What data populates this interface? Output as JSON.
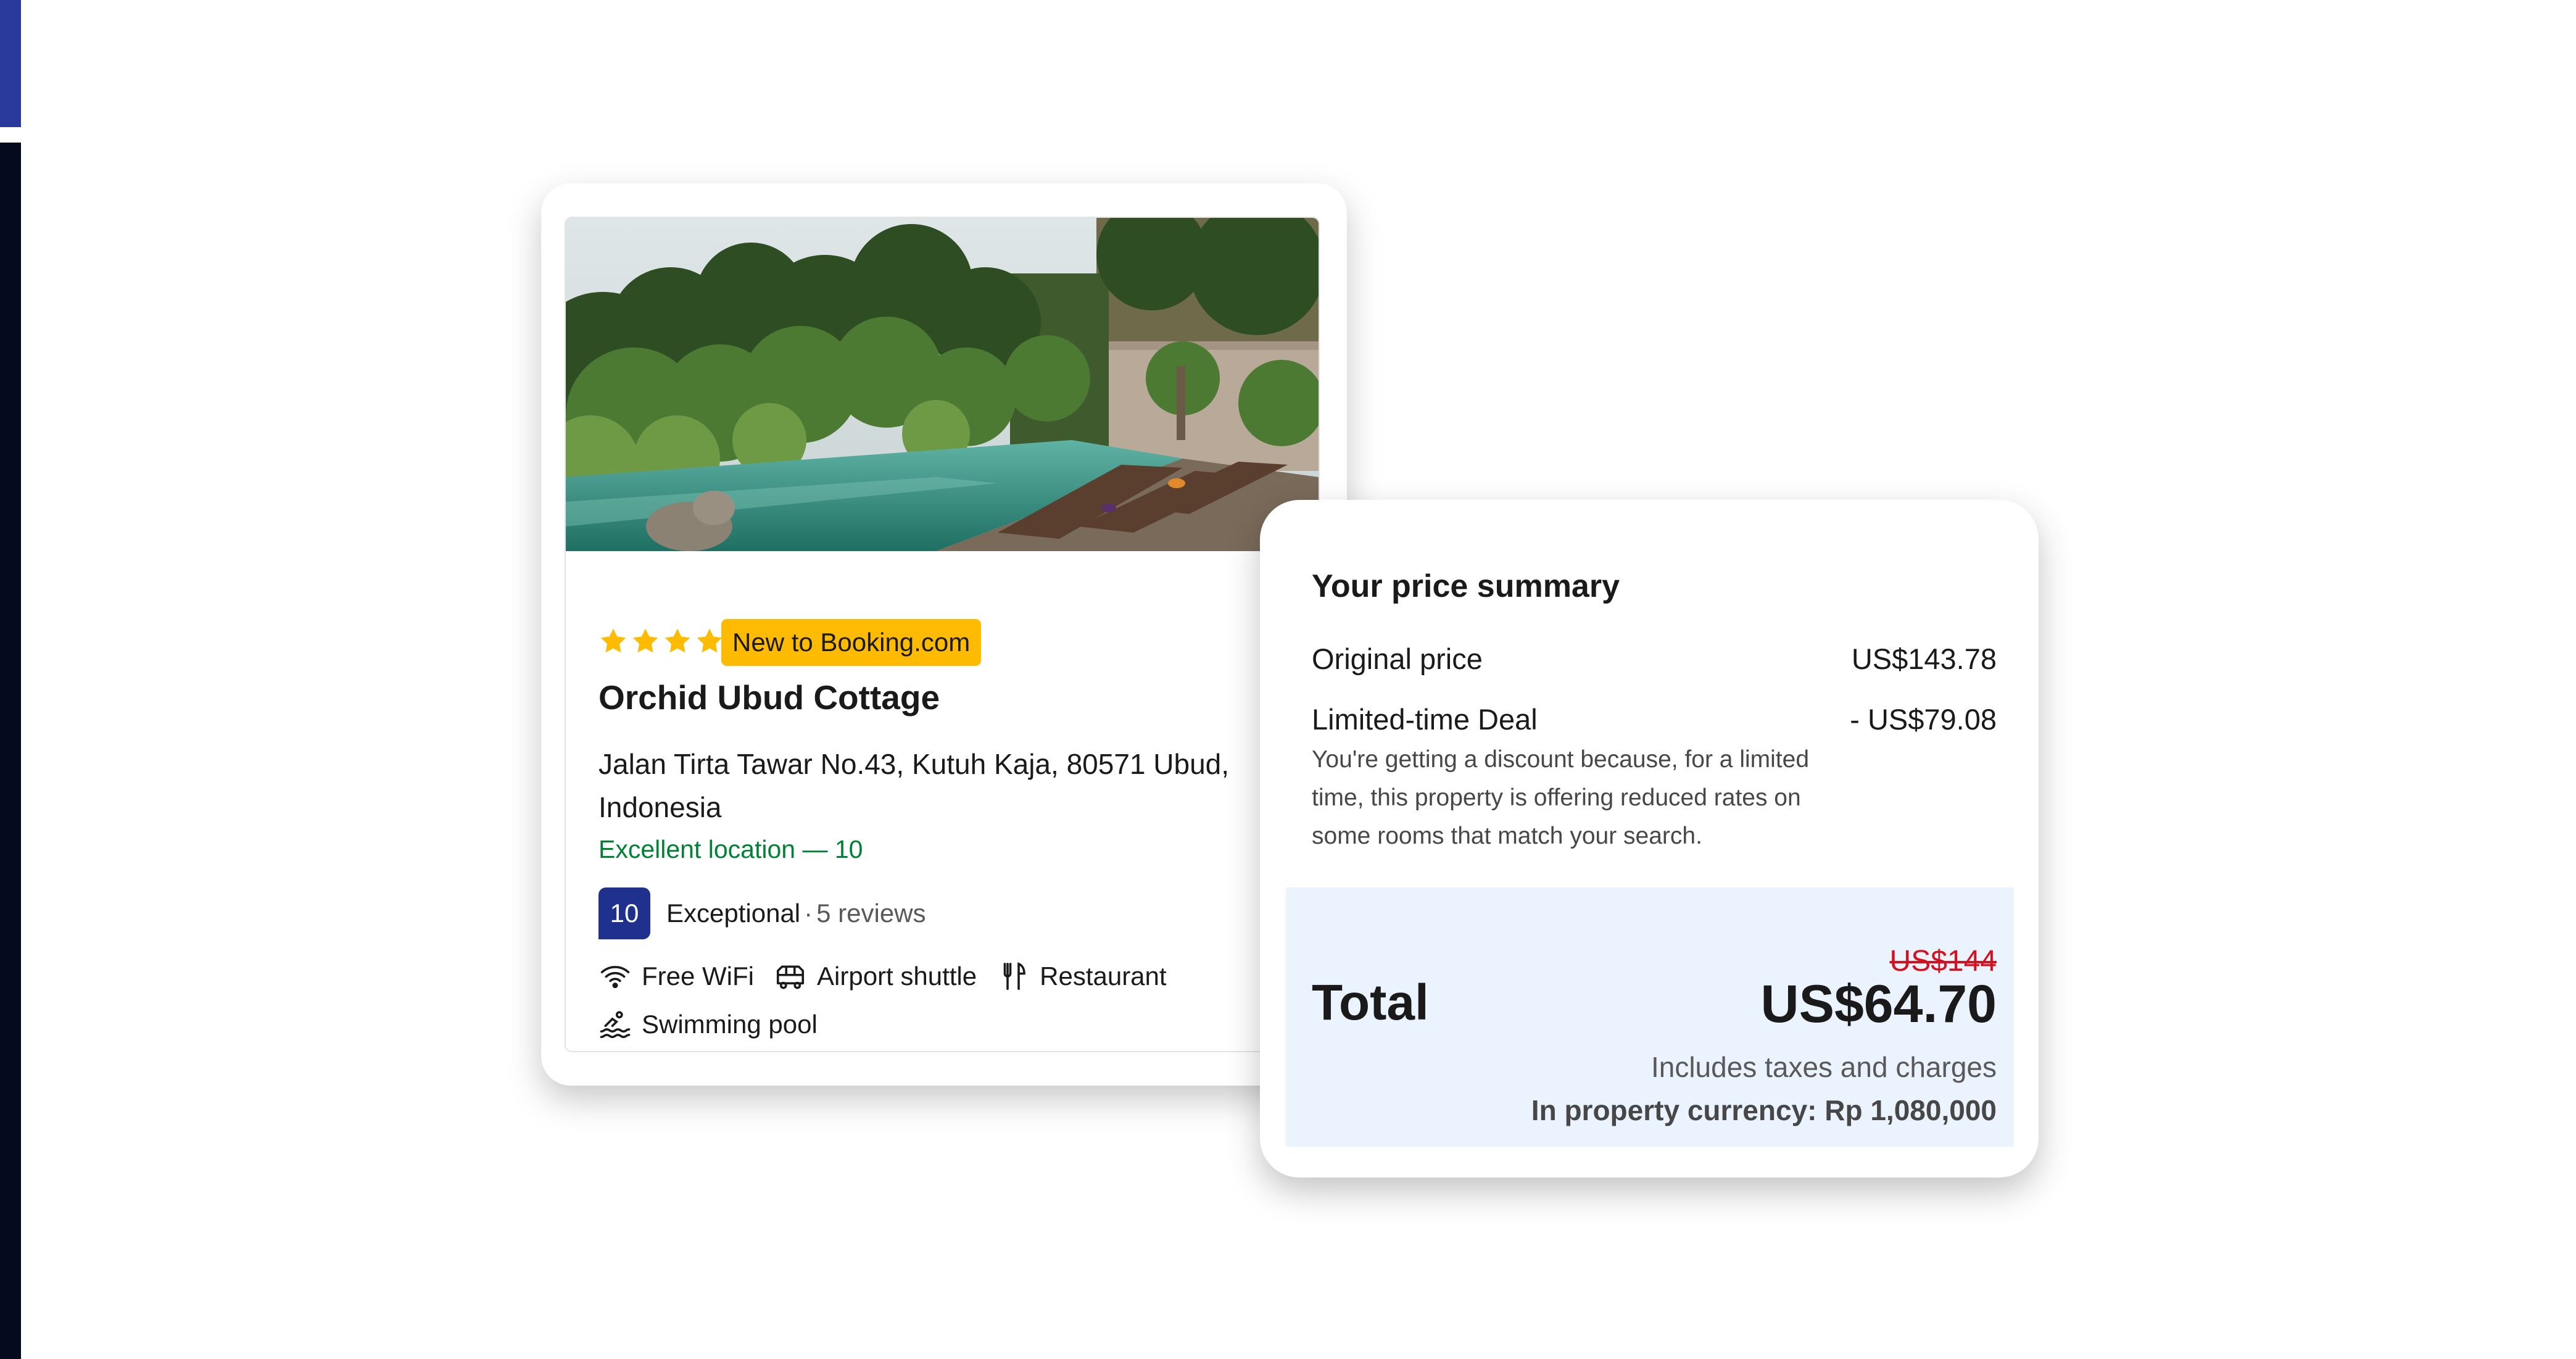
{
  "listing": {
    "star_rating": 4,
    "badge": "New to Booking.com",
    "name": "Orchid Ubud Cottage",
    "address": "Jalan Tirta Tawar No.43, Kutuh Kaja, 80571 Ubud, Indonesia",
    "location_score": "Excellent location — 10",
    "review_score": "10",
    "review_label": "Exceptional",
    "review_separator": "·",
    "review_count": "5 reviews",
    "amenities": [
      {
        "icon": "wifi-icon",
        "label": "Free WiFi"
      },
      {
        "icon": "shuttle-icon",
        "label": "Airport shuttle"
      },
      {
        "icon": "restaurant-icon",
        "label": "Restaurant"
      },
      {
        "icon": "pool-icon",
        "label": "Swimming pool"
      }
    ]
  },
  "price_summary": {
    "title": "Your price summary",
    "original_label": "Original price",
    "original_value": "US$143.78",
    "deal_label": "Limited-time Deal",
    "deal_value": "- US$79.08",
    "deal_note": "You're getting a discount because, for a limited time, this property is offering reduced rates on some rooms that match your search.",
    "total_label": "Total",
    "old_price": "US$144",
    "total_price": "US$64.70",
    "taxes_note": "Includes taxes and charges",
    "property_currency": "In property currency: Rp 1,080,000"
  },
  "colors": {
    "brand_dark_blue": "#1f318c",
    "star_yellow": "#febb02",
    "location_green": "#008234",
    "strike_red": "#d4111e",
    "total_panel": "#ebf3ff",
    "left_edge_blue": "#2a3a9c",
    "left_edge_dark": "#050a1e"
  }
}
